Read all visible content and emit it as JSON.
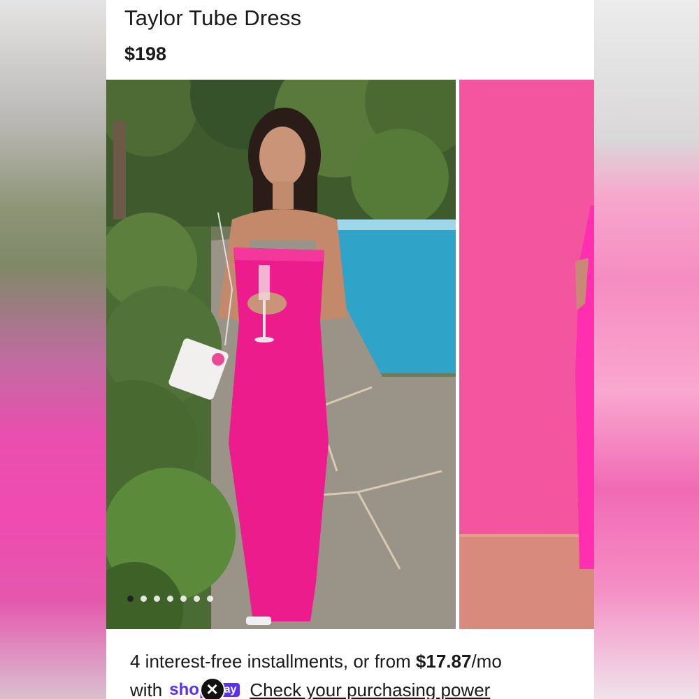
{
  "product": {
    "title": "Taylor Tube Dress",
    "price": "$198"
  },
  "gallery": {
    "image_count": 7,
    "active_index": 0,
    "main_image_icon": "product-photo-outdoor-pool",
    "next_image_icon": "product-photo-studio-pink"
  },
  "financing": {
    "text_prefix": "4 interest-free installments, or from ",
    "amount": "$17.87",
    "text_suffix": "/mo",
    "with_label": "with",
    "provider_shop": "shop",
    "provider_pay": "ay",
    "close_icon": "close-icon",
    "link_text": "Check your purchasing power"
  },
  "colors": {
    "dress_pink": "#ec1c8c",
    "shop_pay_purple": "#5a31f4",
    "studio_pink": "#f25aa6"
  }
}
